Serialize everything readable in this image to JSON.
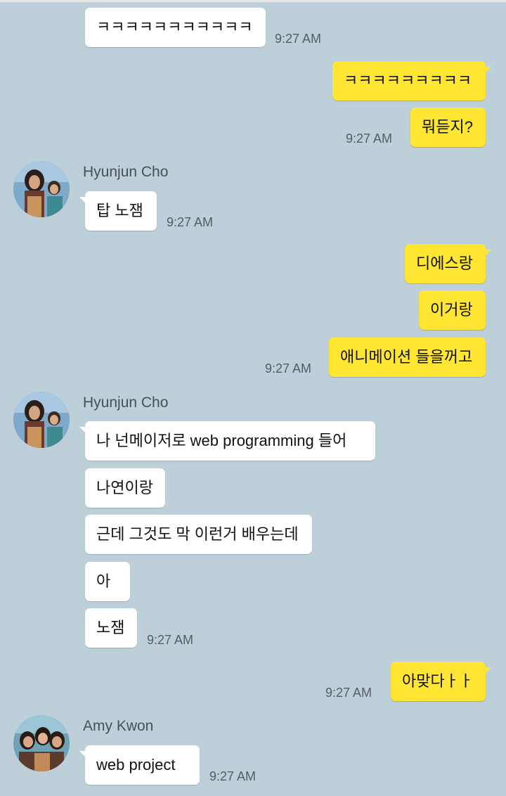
{
  "colors": {
    "background": "#bdd0da",
    "incoming_bubble": "#ffffff",
    "outgoing_bubble": "#fee632",
    "time_text": "#555c63"
  },
  "messages": {
    "m1": "ㅋㅋㅋㅋㅋㅋㅋㅋㅋㅋㅋ",
    "t1": "9:27 AM",
    "m2": "ㅋㅋㅋㅋㅋㅋㅋㅋㅋ",
    "m3": "뭐듣지?",
    "t2": "9:27 AM",
    "sender1": "Hyunjun Cho",
    "m4": "탑 노잼",
    "t3": "9:27 AM",
    "m5": "디에스랑",
    "m6": "이거랑",
    "m7": "애니메이션 들을꺼고",
    "t4": "9:27 AM",
    "sender2": "Hyunjun Cho",
    "m8": "나 넌메이저로 web programming 들어",
    "m9": "나연이랑",
    "m10": "근데 그것도 막 이런거 배우는데",
    "m11": "아",
    "m12": "노잼",
    "t5": "9:27 AM",
    "m13": "아맞다ㅏㅏ",
    "t6": "9:27 AM",
    "sender3": "Amy Kwon",
    "m14": "web project",
    "t7": "9:27 AM"
  },
  "avatars": {
    "a1": "profile-photo",
    "a2": "profile-photo",
    "a3": "profile-photo"
  }
}
